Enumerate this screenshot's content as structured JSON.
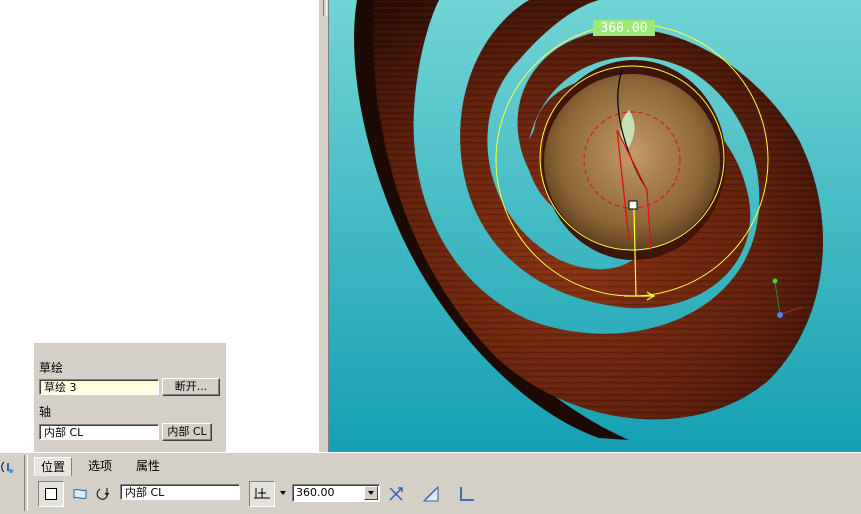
{
  "viewport": {
    "dimension_value": "360.00"
  },
  "collector": {
    "sketch_label": "草绘",
    "sketch_value": "草绘 3",
    "sketch_button": "断开...",
    "axis_label": "轴",
    "axis_value": "内部 CL",
    "axis_button": "内部 CL"
  },
  "dashboard": {
    "tabs": [
      {
        "label": "位置"
      },
      {
        "label": "选项"
      },
      {
        "label": "属性"
      }
    ],
    "axis_field": "内部 CL",
    "angle_value": "360.00"
  },
  "colors": {
    "background_top": "#6fd0d0",
    "background_bottom": "#1aa5b5",
    "wood_dark": "#3a1206",
    "wood_mid": "#7a2a10",
    "highlight_yellow": "#ffff40",
    "dimension_box": "#9ee878"
  }
}
